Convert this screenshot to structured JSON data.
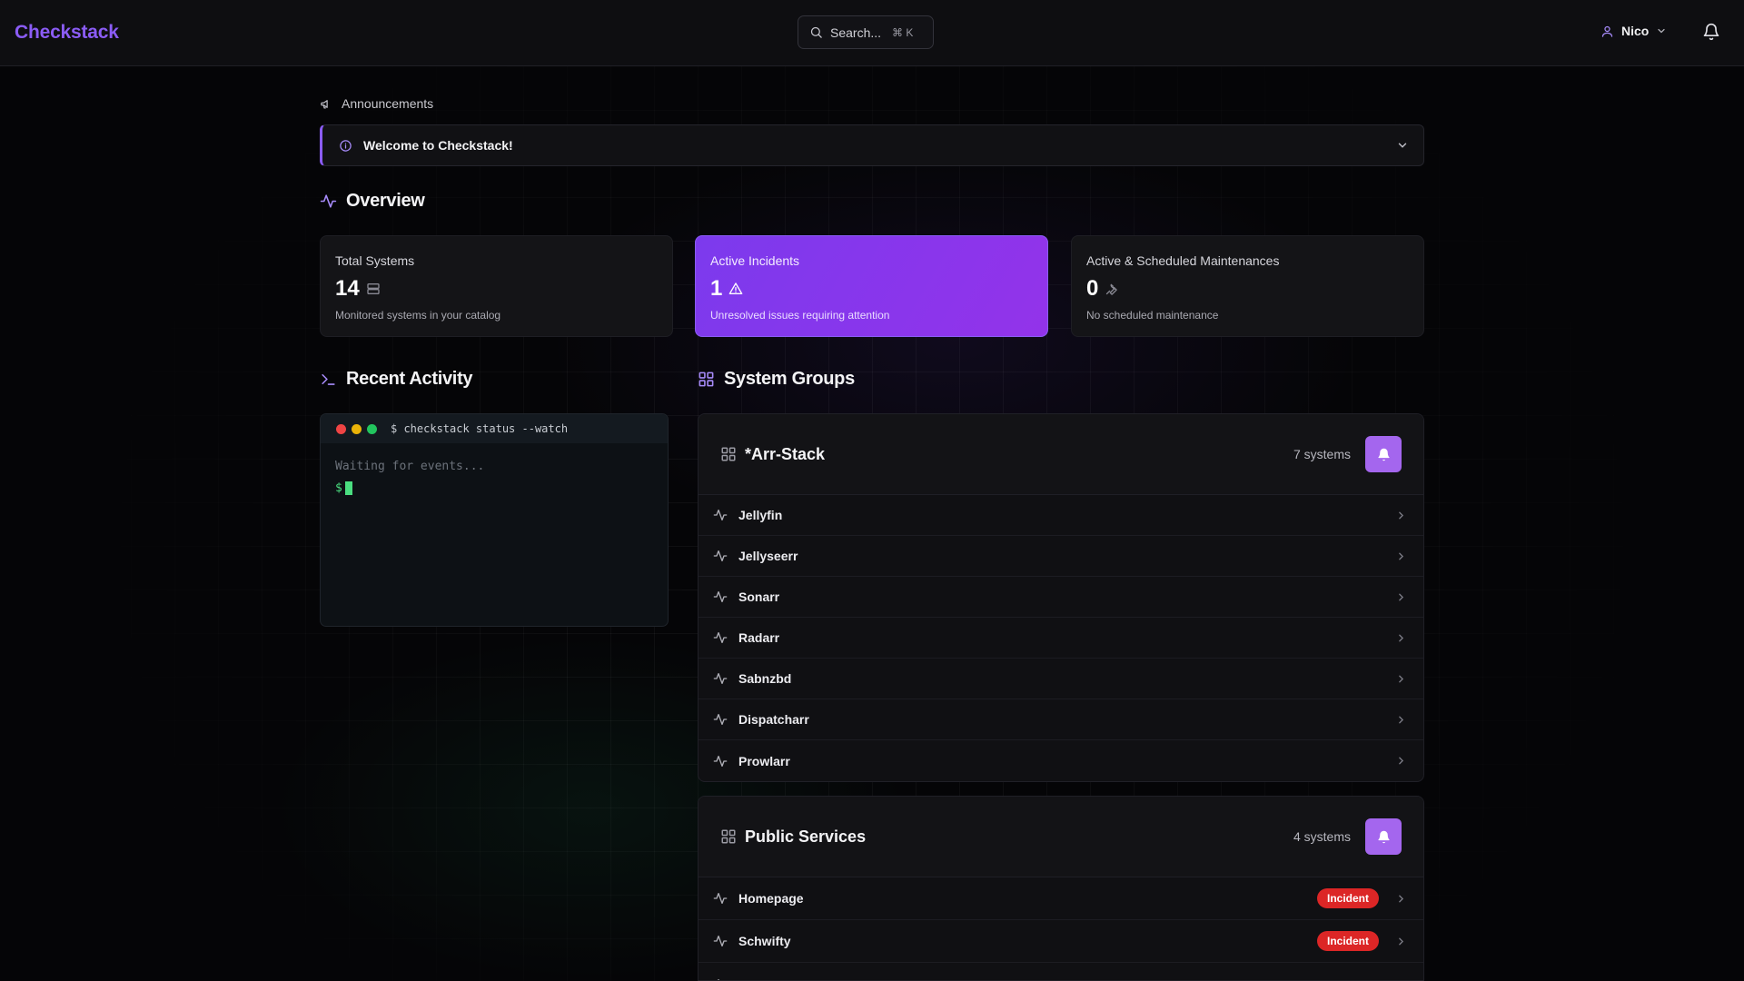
{
  "header": {
    "brand": "Checkstack",
    "search_label": "Search...",
    "search_shortcut": "⌘ K",
    "user_name": "Nico"
  },
  "announcements": {
    "label": "Announcements",
    "items": [
      {
        "title": "Welcome to Checkstack!"
      }
    ]
  },
  "overview": {
    "title": "Overview",
    "cards": [
      {
        "title": "Total Systems",
        "value": "14",
        "subtitle": "Monitored systems in your catalog",
        "icon": "server-icon"
      },
      {
        "title": "Active Incidents",
        "value": "1",
        "subtitle": "Unresolved issues requiring attention",
        "icon": "warning-icon"
      },
      {
        "title": "Active & Scheduled Maintenances",
        "value": "0",
        "subtitle": "No scheduled maintenance",
        "icon": "wrench-icon"
      }
    ]
  },
  "recent_activity": {
    "title": "Recent Activity",
    "command": "$ checkstack status --watch",
    "waiting": "Waiting for events...",
    "prompt": "$"
  },
  "system_groups": {
    "title": "System Groups",
    "groups": [
      {
        "name": "*Arr-Stack",
        "count": "7 systems",
        "systems": [
          {
            "name": "Jellyfin"
          },
          {
            "name": "Jellyseerr"
          },
          {
            "name": "Sonarr"
          },
          {
            "name": "Radarr"
          },
          {
            "name": "Sabnzbd"
          },
          {
            "name": "Dispatcharr"
          },
          {
            "name": "Prowlarr"
          }
        ]
      },
      {
        "name": "Public Services",
        "count": "4 systems",
        "systems": [
          {
            "name": "Homepage",
            "badge": "Incident"
          },
          {
            "name": "Schwifty",
            "badge": "Incident"
          },
          {
            "name": "",
            "badge": ""
          }
        ]
      }
    ]
  },
  "colors": {
    "accent": "#8b5cf6",
    "incident": "#dc2626",
    "terminal_green": "#4ade80"
  }
}
